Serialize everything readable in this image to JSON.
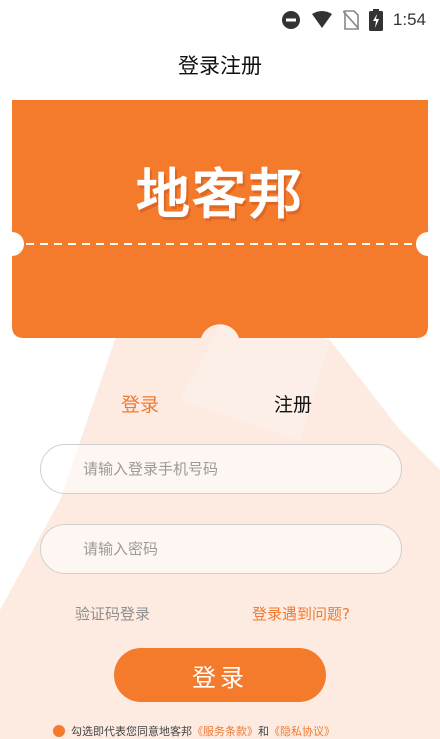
{
  "status_bar": {
    "time": "1:54",
    "icons": [
      "do-not-disturb-icon",
      "wifi-icon",
      "no-sim-icon",
      "battery-charging-icon"
    ]
  },
  "header": {
    "title": "登录注册"
  },
  "brand": {
    "logo_text": "地客邦",
    "accent_color": "#f47a2c"
  },
  "tabs": [
    {
      "label": "登录",
      "active": true
    },
    {
      "label": "注册",
      "active": false
    }
  ],
  "form": {
    "phone": {
      "placeholder": "请输入登录手机号码",
      "value": ""
    },
    "password": {
      "placeholder": "请输入密码",
      "value": ""
    }
  },
  "links": {
    "code_login": "验证码登录",
    "login_problem": "登录遇到问题?"
  },
  "login_button": "登录",
  "agreement": {
    "prefix": "勾选即代表您同意地客邦",
    "service_terms": "《服务条款》",
    "connector": "和",
    "privacy_policy": "《隐私协议》"
  }
}
